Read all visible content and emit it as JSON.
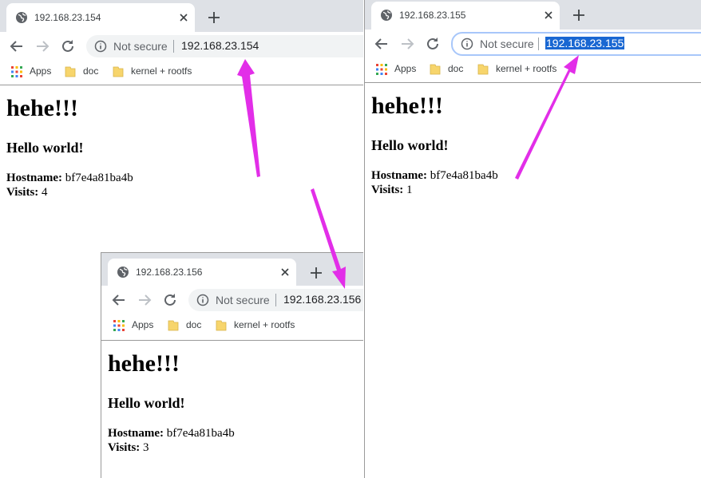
{
  "windows": [
    {
      "id": "a",
      "tab_title": "192.168.23.154",
      "not_secure": "Not secure",
      "url": "192.168.23.154",
      "bookmarks": [
        "Apps",
        "doc",
        "kernel + rootfs"
      ],
      "heading": "hehe!!!",
      "subheading": "Hello world!",
      "hostname_label": "Hostname:",
      "hostname_value": " bf7e4a81ba4b",
      "visits_label": "Visits:",
      "visits_value": " 4"
    },
    {
      "id": "b",
      "tab_title": "192.168.23.155",
      "not_secure": "Not secure",
      "url": "192.168.23.155",
      "url_selected": true,
      "bookmarks": [
        "Apps",
        "doc",
        "kernel + rootfs"
      ],
      "heading": "hehe!!!",
      "subheading": "Hello world!",
      "hostname_label": "Hostname:",
      "hostname_value": " bf7e4a81ba4b",
      "visits_label": "Visits:",
      "visits_value": " 1"
    },
    {
      "id": "c",
      "tab_title": "192.168.23.156",
      "not_secure": "Not secure",
      "url": "192.168.23.156",
      "bookmarks": [
        "Apps",
        "doc",
        "kernel + rootfs"
      ],
      "heading": "hehe!!!",
      "subheading": "Hello world!",
      "hostname_label": "Hostname:",
      "hostname_value": " bf7e4a81ba4b",
      "visits_label": "Visits:",
      "visits_value": " 3"
    }
  ],
  "colors": {
    "tabstrip": "#dee1e6",
    "arrow": "#e22ee8",
    "selection": "#1967d2",
    "folder": "#f7d56c"
  },
  "icons": [
    "globe-icon",
    "close-icon",
    "plus-icon",
    "back-arrow-icon",
    "forward-arrow-icon",
    "reload-icon",
    "info-icon",
    "apps-grid-icon",
    "folder-icon"
  ]
}
